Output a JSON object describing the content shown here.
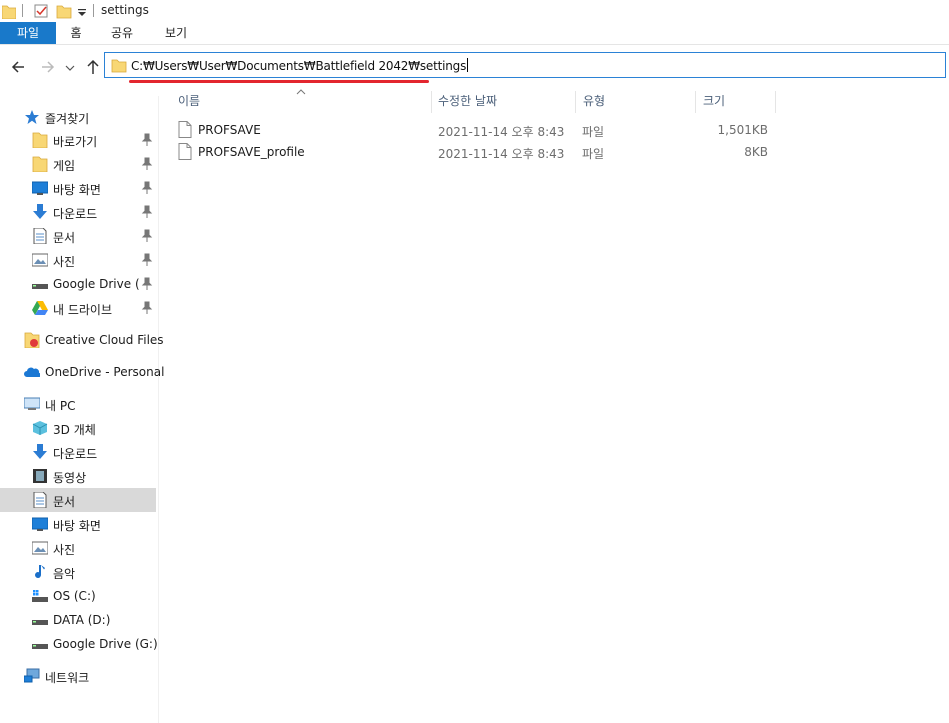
{
  "window": {
    "title": "settings"
  },
  "ribbon": {
    "tabs": [
      "파일",
      "홈",
      "공유",
      "보기"
    ]
  },
  "address": {
    "path": "C:₩Users₩User₩Documents₩Battlefield 2042₩settings"
  },
  "sidebar": {
    "quick_access": "즐겨찾기",
    "quick_items": [
      "바로가기",
      "게임",
      "바탕 화면",
      "다운로드",
      "문서",
      "사진",
      "Google Drive (G",
      "내 드라이브"
    ],
    "creative_cloud": "Creative Cloud Files",
    "onedrive": "OneDrive - Personal",
    "this_pc": "내 PC",
    "pc_items": [
      "3D 개체",
      "다운로드",
      "동영상",
      "문서",
      "바탕 화면",
      "사진",
      "음악",
      "OS (C:)",
      "DATA (D:)",
      "Google Drive (G:)"
    ],
    "network": "네트워크"
  },
  "columns": {
    "name": "이름",
    "date": "수정한 날짜",
    "type": "유형",
    "size": "크기"
  },
  "files": [
    {
      "name": "PROFSAVE",
      "date": "2021-11-14 오후 8:43",
      "type": "파일",
      "size": "1,501KB"
    },
    {
      "name": "PROFSAVE_profile",
      "date": "2021-11-14 오후 8:43",
      "type": "파일",
      "size": "8KB"
    }
  ],
  "colors": {
    "accent": "#1979ca",
    "highlight": "#e3262f",
    "selected": "#d9d9d9"
  }
}
